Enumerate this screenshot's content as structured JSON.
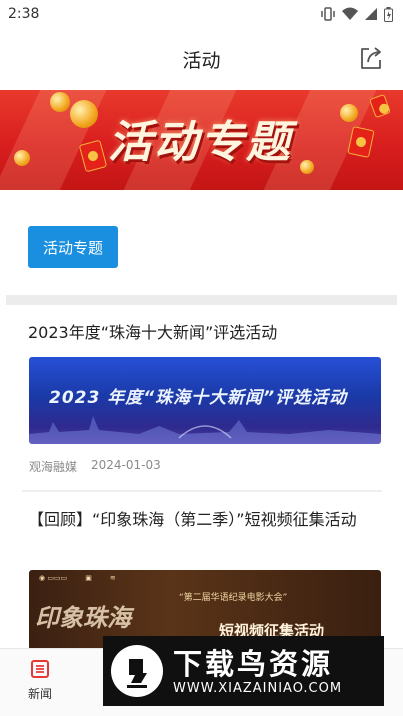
{
  "status_bar": {
    "time": "2:38"
  },
  "nav": {
    "title": "活动",
    "share_icon": "share-icon"
  },
  "banner": {
    "title": "活动专题"
  },
  "topic_button": {
    "label": "活动专题"
  },
  "articles": [
    {
      "title": "2023年度“珠海十大新闻”评选活动",
      "image_text": "2023 年度“珠海十大新闻”评选活动",
      "source": "观海融媒",
      "date": "2024-01-03"
    },
    {
      "title": "【回顾】“印象珠海（第二季）”短视频征集活动",
      "image_caption": "“第二届华语纪录电影大会”",
      "image_title": "印象珠海",
      "image_sub": "短视频征集活动"
    }
  ],
  "tab_bar": {
    "items": [
      {
        "label": "新闻",
        "icon": "news-icon"
      }
    ]
  },
  "watermark": {
    "title": "下载鸟资源",
    "url": "WWW.XIAZAINIAO.COM"
  },
  "colors": {
    "primary": "#1a8fe0",
    "banner_red": "#d91e1e"
  }
}
